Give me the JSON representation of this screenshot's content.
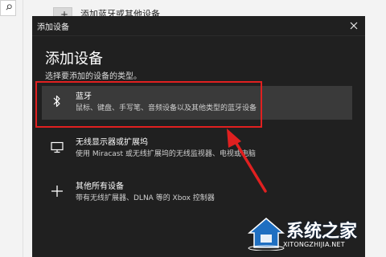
{
  "background": {
    "item_label": "添加蓝牙或其他设备",
    "search_icon": "search-icon"
  },
  "dialog": {
    "window_title": "添加设备",
    "heading": "添加设备",
    "subheading": "选择要添加的设备的类型。",
    "close_icon": "close-icon",
    "options": [
      {
        "title": "蓝牙",
        "description": "鼠标、键盘、手写笔、音频设备以及其他类型的蓝牙设备",
        "icon": "bluetooth-icon",
        "selected": true
      },
      {
        "title": "无线显示器或扩展坞",
        "description": "使用 Miracast 或无线扩展坞的无线监视器、电视或电脑",
        "icon": "monitor-icon",
        "selected": false
      },
      {
        "title": "其他所有设备",
        "description": "带有无线扩展器、DLNA 等的 Xbox 控制器",
        "icon": "plus-icon",
        "selected": false
      }
    ]
  },
  "annotation": {
    "highlight_color": "#e02020"
  },
  "watermark": {
    "text": "系统之家",
    "url": "XITONGZHIJIA.NET"
  }
}
